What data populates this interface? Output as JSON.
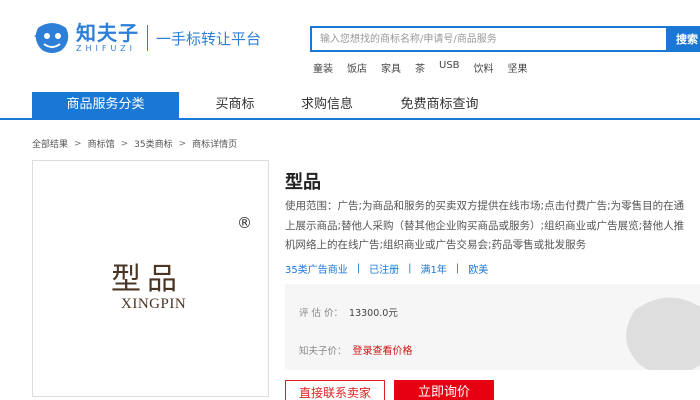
{
  "brand": {
    "logo_cn": "知夫子",
    "logo_en": "ZHIFUZI",
    "slogan": "一手标转让平台",
    "accent_color": "#1a78d4"
  },
  "search": {
    "placeholder": "输入您想找的商标名称/申请号/商品服务",
    "button_label": "搜索",
    "hot_words": [
      "童装",
      "饭店",
      "家具",
      "茶",
      "USB",
      "饮料",
      "坚果"
    ]
  },
  "nav": {
    "items": [
      {
        "label": "商品服务分类",
        "active": true
      },
      {
        "label": "买商标",
        "active": false
      },
      {
        "label": "求购信息",
        "active": false
      },
      {
        "label": "免费商标查询",
        "active": false
      }
    ]
  },
  "breadcrumb": [
    "全部结果",
    "商标馆",
    "35类商标",
    "商标详情页"
  ],
  "trademark": {
    "name_cn": "型品",
    "name_en": "XINGPIN",
    "registered_symbol": "®"
  },
  "detail": {
    "title": "型品",
    "scope_lines": [
      "使用范围：广告;为商品和服务的买卖双方提供在线市场;点击付费广告;为零售目的在通",
      "上展示商品;替他人采购（替其他企业购买商品或服务）;组织商业或广告展览;替他人推",
      "机网络上的在线广告;组织商业或广告交易会;药品零售或批发服务"
    ],
    "tags": [
      "35类广告商业",
      "已注册",
      "满1年",
      "欧美"
    ],
    "price_label": "评 估 价：",
    "price_value": "13300.0元",
    "member_price_label": "知夫子价：",
    "member_price_value": "登录查看价格",
    "contact_button": "直接联系卖家",
    "ask_button": "立即询价",
    "highlight_color": "#e60012"
  }
}
